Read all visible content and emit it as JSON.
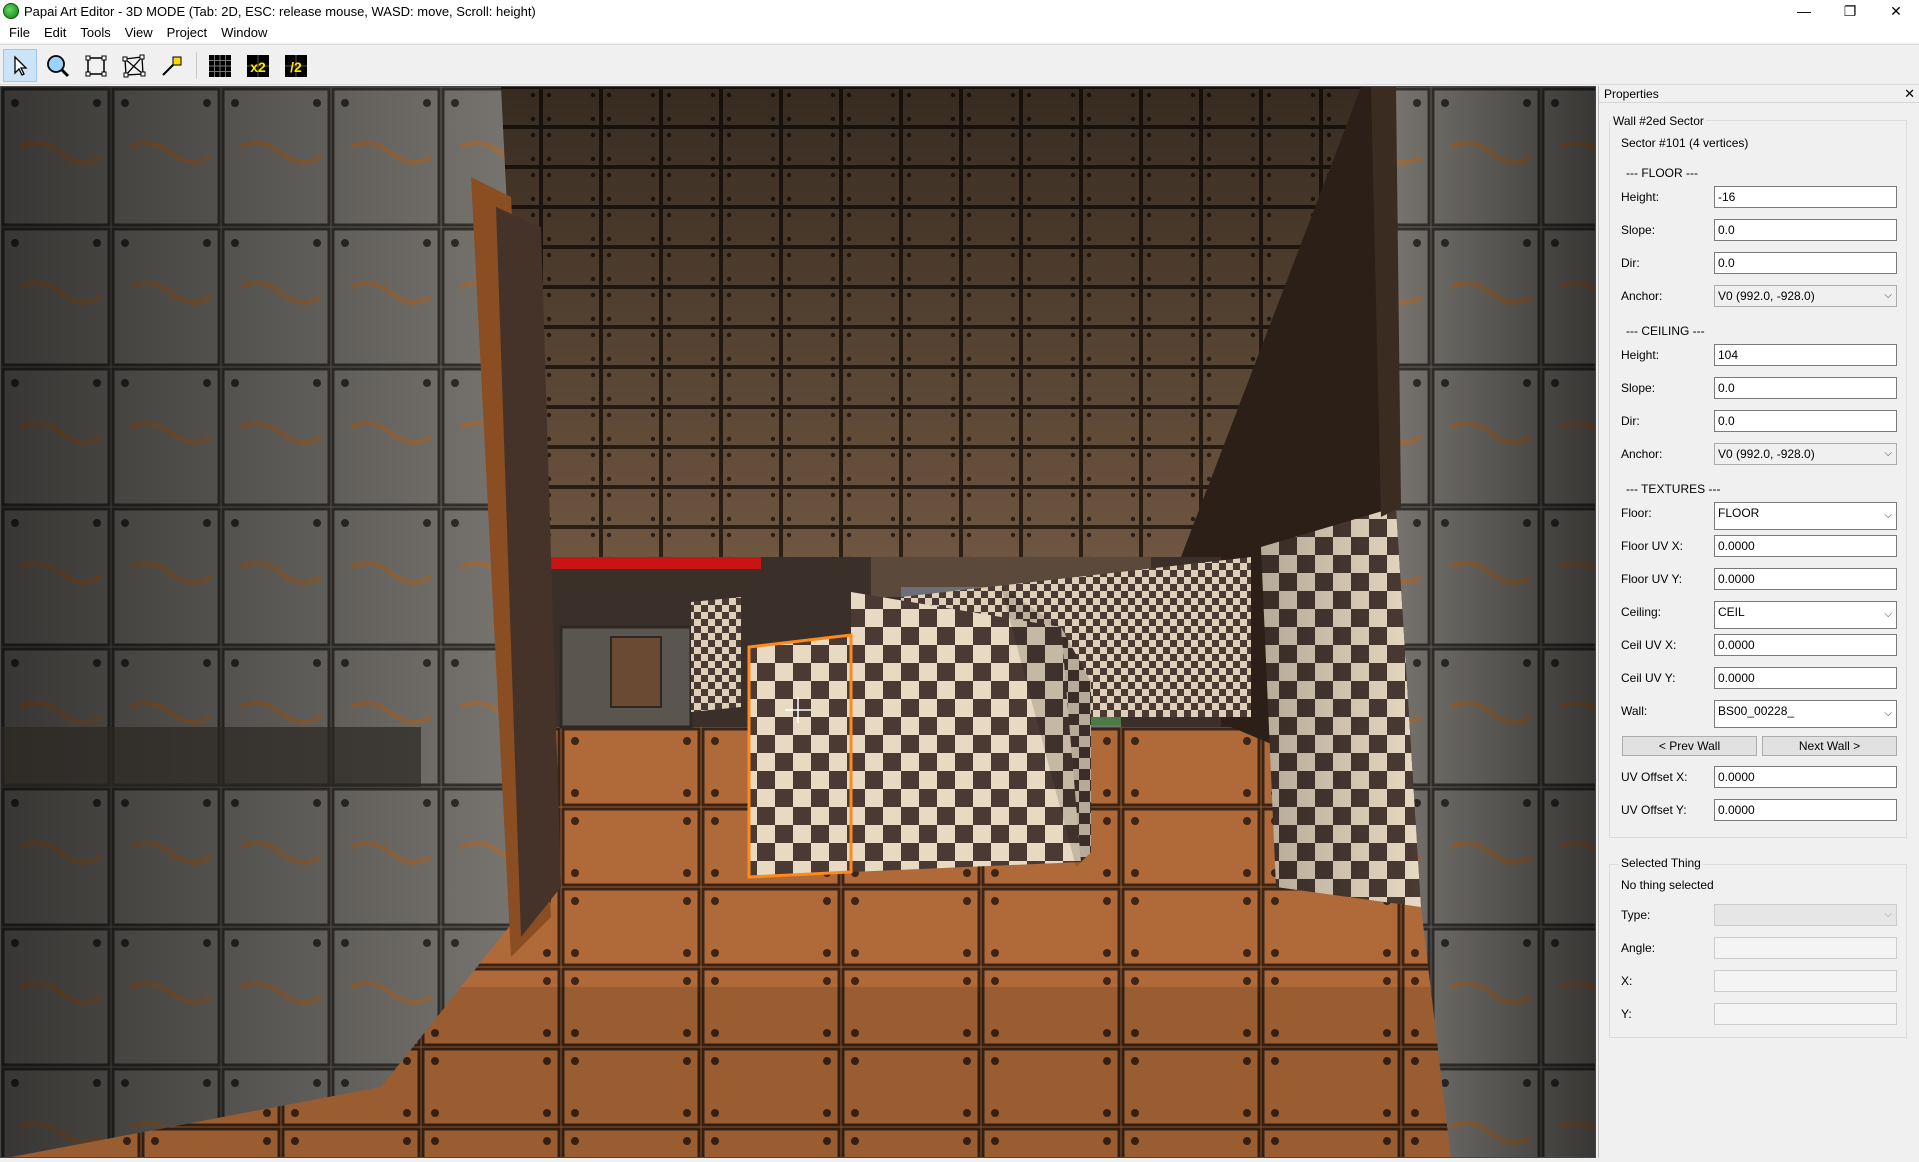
{
  "window": {
    "title": "Papai Art Editor - 3D MODE (Tab: 2D, ESC: release mouse, WASD: move, Scroll: height)",
    "minimize": "—",
    "restore": "❐",
    "close": "✕"
  },
  "menu": [
    "File",
    "Edit",
    "Tools",
    "View",
    "Project",
    "Window"
  ],
  "toolbar": {
    "tools": [
      {
        "icon": "select-arrow-icon",
        "active": true
      },
      {
        "icon": "zoom-icon",
        "active": false
      },
      {
        "icon": "draw-sector-icon",
        "active": false
      },
      {
        "icon": "vertex-edit-icon",
        "active": false
      },
      {
        "icon": "thing-tool-icon",
        "active": false
      },
      {
        "icon": "grid-icon",
        "active": false
      },
      {
        "icon": "grid-double-icon",
        "active": false
      },
      {
        "icon": "grid-half-icon",
        "active": false
      }
    ],
    "grid_double_label": "x2",
    "grid_half_label": "/2"
  },
  "properties": {
    "panel_title": "Properties",
    "close": "✕",
    "group_title": "Wall #2ed Sector",
    "sector_info": "Sector #101 (4 vertices)",
    "floor": {
      "header": "--- FLOOR ---",
      "height_label": "Height:",
      "height": "-16",
      "slope_label": "Slope:",
      "slope": "0.0",
      "dir_label": "Dir:",
      "dir": "0.0",
      "anchor_label": "Anchor:",
      "anchor": "V0 (992.0, -928.0)"
    },
    "ceiling": {
      "header": "--- CEILING ---",
      "height_label": "Height:",
      "height": "104",
      "slope_label": "Slope:",
      "slope": "0.0",
      "dir_label": "Dir:",
      "dir": "0.0",
      "anchor_label": "Anchor:",
      "anchor": "V0 (992.0, -928.0)"
    },
    "textures": {
      "header": "--- TEXTURES ---",
      "floor_label": "Floor:",
      "floor": "FLOOR",
      "floor_uvx_label": "Floor UV X:",
      "floor_uvx": "0.0000",
      "floor_uvy_label": "Floor UV Y:",
      "floor_uvy": "0.0000",
      "ceiling_label": "Ceiling:",
      "ceiling": "CEIL",
      "ceil_uvx_label": "Ceil UV X:",
      "ceil_uvx": "0.0000",
      "ceil_uvy_label": "Ceil UV Y:",
      "ceil_uvy": "0.0000",
      "wall_label": "Wall:",
      "wall": "BS00_00228_",
      "prev_wall": "< Prev Wall",
      "next_wall": "Next Wall >",
      "uv_offx_label": "UV Offset X:",
      "uv_offx": "0.0000",
      "uv_offy_label": "UV Offset Y:",
      "uv_offy": "0.0000"
    },
    "thing": {
      "group_title": "Selected Thing",
      "status": "No thing selected",
      "type_label": "Type:",
      "angle_label": "Angle:",
      "x_label": "X:",
      "y_label": "Y:"
    }
  },
  "colors": {
    "selection_outline": "#ff8a1a",
    "active_tool_bg": "#cce4f7",
    "grid_label_yellow": "#ffe600"
  }
}
